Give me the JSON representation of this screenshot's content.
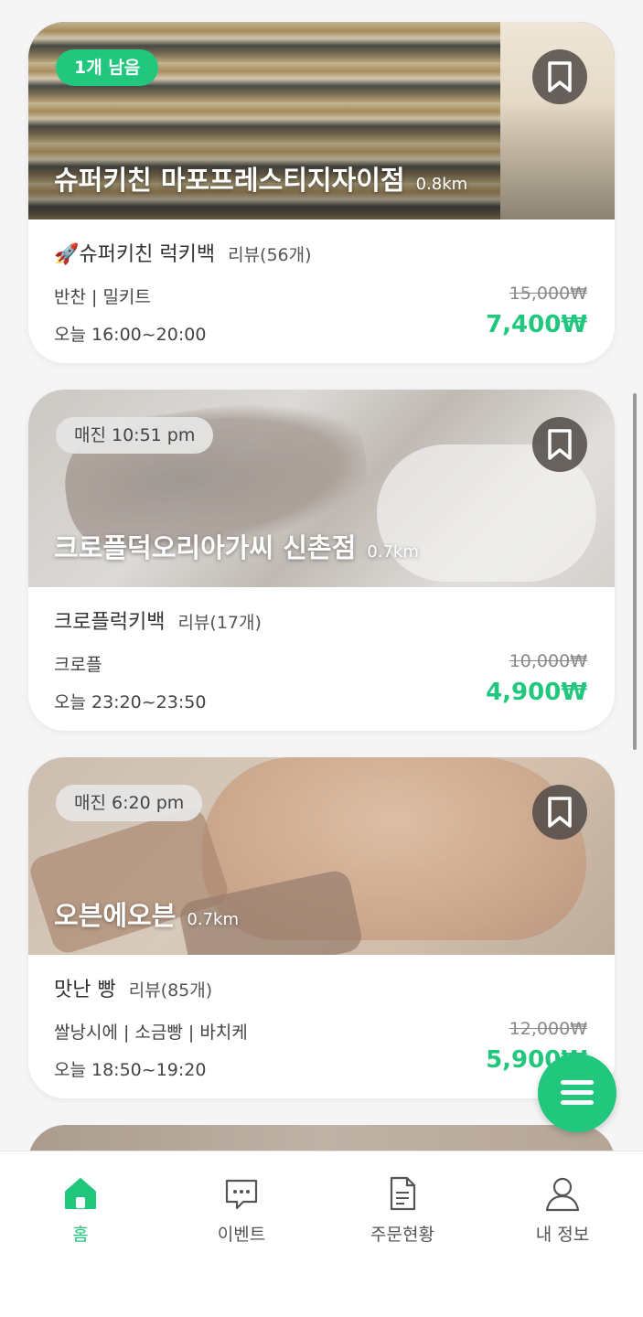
{
  "accent_color": "#22c77e",
  "cards": [
    {
      "tag": "1개 남음",
      "tag_style": "green",
      "store_name": "슈퍼키친 마포프레스티지자이점",
      "distance": "0.8km",
      "product": "🚀슈퍼키친 럭키백",
      "reviews": "리뷰(56개)",
      "category": "반찬 | 밀키트",
      "pickup_time": "오늘 16:00~20:00",
      "original_price": "15,000₩",
      "price": "7,400₩"
    },
    {
      "tag": "매진 10:51 pm",
      "tag_style": "gray",
      "store_name": "크로플덕오리아가씨 신촌점",
      "distance": "0.7km",
      "product": "크로플럭키백",
      "reviews": "리뷰(17개)",
      "category": "크로플",
      "pickup_time": "오늘 23:20~23:50",
      "original_price": "10,000₩",
      "price": "4,900₩"
    },
    {
      "tag": "매진 6:20 pm",
      "tag_style": "gray",
      "store_name": "오븐에오븐",
      "distance": "0.7km",
      "product": "맛난 빵",
      "reviews": "리뷰(85개)",
      "category": "쌀낭시에 | 소금빵 | 바치케",
      "pickup_time": "오늘 18:50~19:20",
      "original_price": "12,000₩",
      "price": "5,900₩"
    }
  ],
  "fab_icon": "menu-icon",
  "nav": {
    "items": [
      {
        "label": "홈",
        "icon": "home-icon",
        "active": true
      },
      {
        "label": "이벤트",
        "icon": "chat-icon",
        "active": false
      },
      {
        "label": "주문현황",
        "icon": "document-icon",
        "active": false
      },
      {
        "label": "내 정보",
        "icon": "user-icon",
        "active": false
      }
    ]
  }
}
